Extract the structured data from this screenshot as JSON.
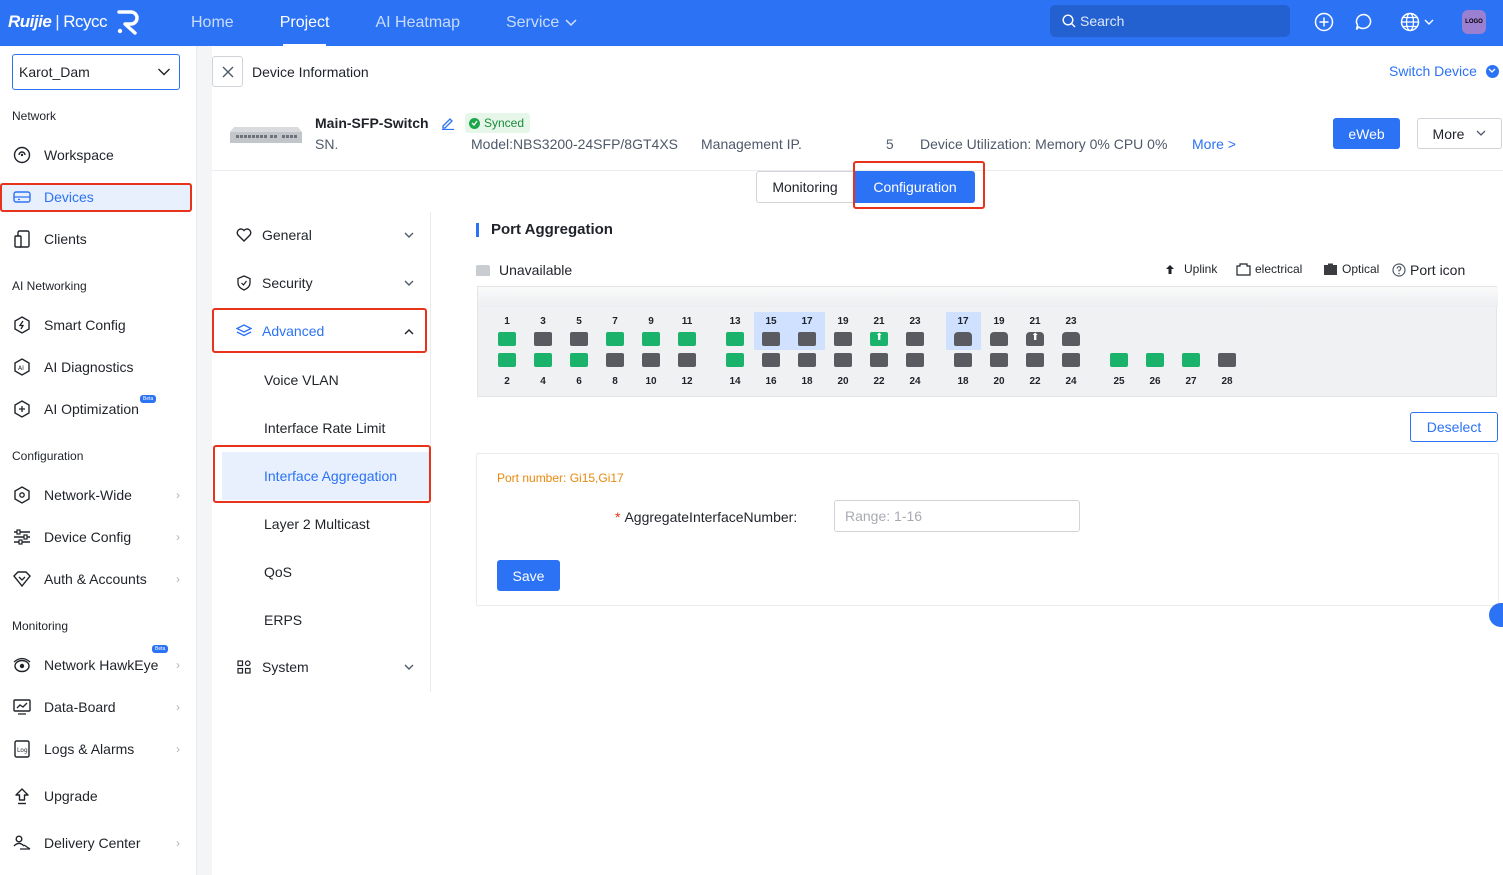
{
  "topbar": {
    "brand_main": "Ruijie",
    "brand_sub": "Rcycc",
    "nav": [
      {
        "label": "Home",
        "active": false
      },
      {
        "label": "Project",
        "active": true
      },
      {
        "label": "AI Heatmap",
        "active": false
      },
      {
        "label": "Service",
        "active": false,
        "dropdown": true
      }
    ],
    "search_placeholder": "Search",
    "avatar_text": "LOGO"
  },
  "sidebar": {
    "project": "Karot_Dam",
    "sections": {
      "network": "Network",
      "ai_networking": "AI Networking",
      "configuration": "Configuration",
      "monitoring": "Monitoring"
    },
    "items": {
      "workspace": "Workspace",
      "devices": "Devices",
      "clients": "Clients",
      "smart_config": "Smart Config",
      "ai_diagnostics": "AI Diagnostics",
      "ai_optimization": "AI Optimization",
      "network_wide": "Network-Wide",
      "device_config": "Device Config",
      "auth_accounts": "Auth & Accounts",
      "network_hawkeye": "Network HawkEye",
      "data_board": "Data-Board",
      "logs_alarms": "Logs & Alarms",
      "upgrade": "Upgrade",
      "delivery_center": "Delivery Center"
    },
    "beta_label": "Beta"
  },
  "header": {
    "title": "Device Information",
    "switch_device": "Switch Device"
  },
  "device": {
    "name": "Main-SFP-Switch",
    "status": "Synced",
    "sn_label": "SN.",
    "model": "Model:NBS3200-24SFP/8GT4XS",
    "mgmt_ip_label": "Management IP.",
    "mgmt_ip_tail": "5",
    "utilization": "Device Utilization: Memory 0% CPU 0%",
    "more_link": "More >",
    "eweb": "eWeb",
    "more_btn": "More"
  },
  "tabs": {
    "monitoring": "Monitoring",
    "configuration": "Configuration"
  },
  "submenu": {
    "general": "General",
    "security": "Security",
    "advanced": "Advanced",
    "leaves": [
      "Voice VLAN",
      "Interface Rate Limit",
      "Interface Aggregation",
      "Layer 2 Multicast",
      "QoS",
      "ERPS"
    ],
    "system": "System"
  },
  "content": {
    "title": "Port Aggregation",
    "unavailable": "Unavailable",
    "legend": {
      "uplink": "Uplink",
      "electrical": "electrical",
      "optical": "Optical",
      "port_icon": "Port icon"
    },
    "port_groups": [
      {
        "top": [
          "1",
          "3",
          "5",
          "7",
          "9",
          "11"
        ],
        "bottom": [
          "2",
          "4",
          "6",
          "8",
          "10",
          "12"
        ]
      },
      {
        "top": [
          "13",
          "15",
          "17",
          "19",
          "21",
          "23"
        ],
        "bottom": [
          "14",
          "16",
          "18",
          "20",
          "22",
          "24"
        ]
      },
      {
        "top": [
          "17",
          "19",
          "21",
          "23"
        ],
        "bottom": [
          "18",
          "20",
          "22",
          "24"
        ]
      },
      {
        "top": [],
        "bottom": [
          "25",
          "26",
          "27",
          "28"
        ]
      }
    ],
    "deselect": "Deselect",
    "port_number": "Port number: Gi15,Gi17",
    "field_label": "AggregateInterfaceNumber:",
    "field_placeholder": "Range: 1-16",
    "save": "Save"
  },
  "colors": {
    "primary": "#2b72f5",
    "port_green": "#1bb36c",
    "port_dark": "#595b60",
    "highlight": "#e8331c"
  }
}
